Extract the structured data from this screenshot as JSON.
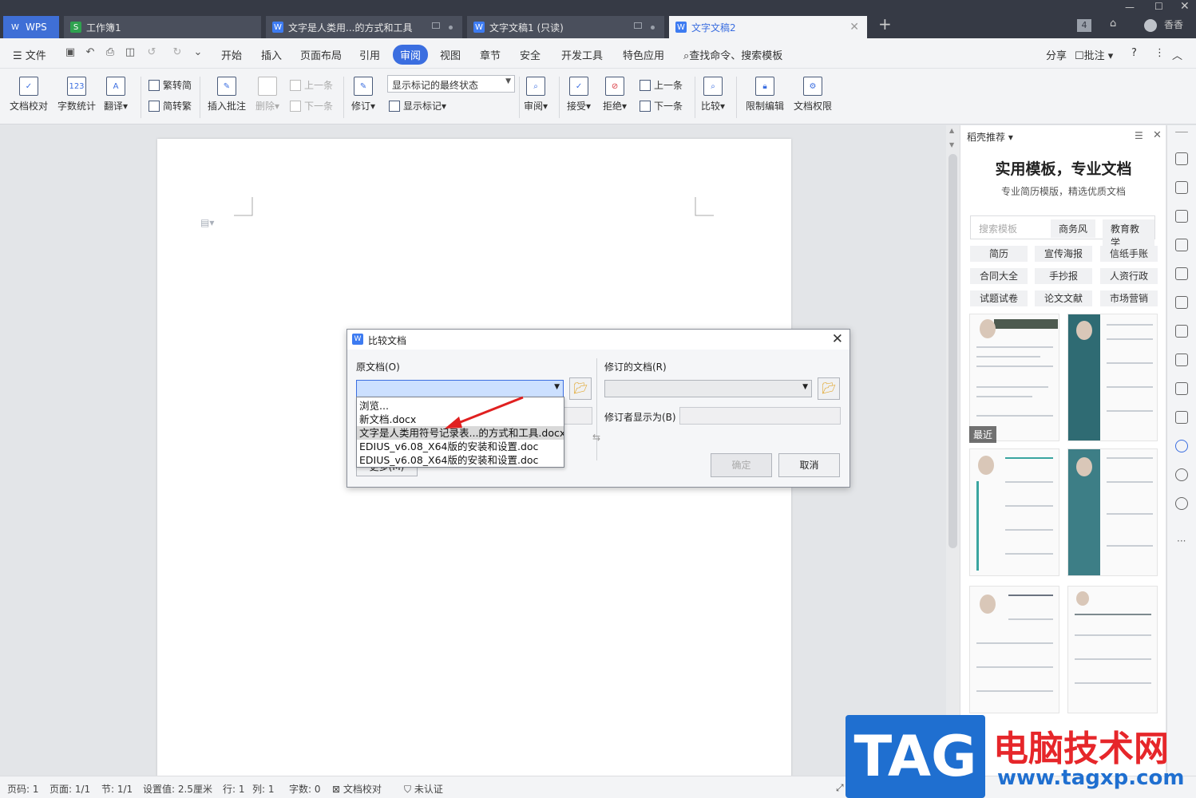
{
  "titlebar": {
    "tabs": [
      {
        "label": "WPS",
        "kind": "home"
      },
      {
        "label": "工作簿1",
        "kind": "sheet"
      },
      {
        "label": "文字是人类用...的方式和工具",
        "kind": "doc"
      },
      {
        "label": "文字文稿1 (只读)",
        "kind": "doc"
      },
      {
        "label": "文字文稿2",
        "kind": "doc",
        "active": true
      }
    ],
    "add_tab": "+",
    "tab_count": "4",
    "user_name": "香香"
  },
  "menubar": {
    "file": "文件",
    "items": [
      "开始",
      "插入",
      "页面布局",
      "引用",
      "审阅",
      "视图",
      "章节",
      "安全",
      "开发工具",
      "特色应用"
    ],
    "active": "审阅",
    "search": "查找命令、搜索模板",
    "share": "分享",
    "comment": "批注",
    "help": "?"
  },
  "ribbon": {
    "doc_check": "文档校对",
    "word_count": "字数统计",
    "translate": "翻译",
    "trad_to_simp": "繁转简",
    "simp_to_trad": "简转繁",
    "insert_comment": "插入批注",
    "delete": "删除",
    "prev": "上一条",
    "next": "下一条",
    "revise": "修订",
    "markup_select": "显示标记的最终状态",
    "show_markup": "显示标记",
    "review": "审阅",
    "accept": "接受",
    "reject": "拒绝",
    "prev2": "上一条",
    "next2": "下一条",
    "compare": "比较",
    "restrict_edit": "限制编辑",
    "doc_permission": "文档权限"
  },
  "dialog": {
    "title": "比较文档",
    "original_label": "原文档(O)",
    "revised_label": "修订的文档(R)",
    "reviser_label": "修订者显示为(B)",
    "ok": "确定",
    "cancel": "取消",
    "more_obscured": "更多(M)",
    "dropdown": [
      "浏览...",
      "新文档.docx",
      "文字是人类用符号记录表...的方式和工具.docx",
      "EDIUS_v6.08_X64版的安装和设置.doc",
      "EDIUS_v6.08_X64版的安装和设置.doc"
    ],
    "dropdown_selected_index": 2
  },
  "panel": {
    "header": "稻壳推荐",
    "title": "实用模板，专业文档",
    "subtitle": "专业简历模版，精选优质文档",
    "search_placeholder": "搜索模板",
    "search_tags": [
      "商务风",
      "教育教学"
    ],
    "categories": [
      "简历",
      "宣传海报",
      "信纸手账",
      "合同大全",
      "手抄报",
      "人资行政",
      "试题试卷",
      "论文文献",
      "市场营销"
    ],
    "recent_badge": "最近"
  },
  "statusbar": {
    "page_no": "页码: 1",
    "pages": "页面: 1/1",
    "section": "节: 1/1",
    "setting": "设置值: 2.5厘米",
    "row": "行: 1",
    "col": "列: 1",
    "words": "字数: 0",
    "doc_check": "文档校对",
    "auth": "未认证"
  },
  "watermark": {
    "logo": "TAG",
    "name": "电脑技术网",
    "url": "www.tagxp.com"
  },
  "colors": {
    "accent": "#3b6ee0",
    "titlebar": "#363a45",
    "arrow": "#e02020"
  }
}
